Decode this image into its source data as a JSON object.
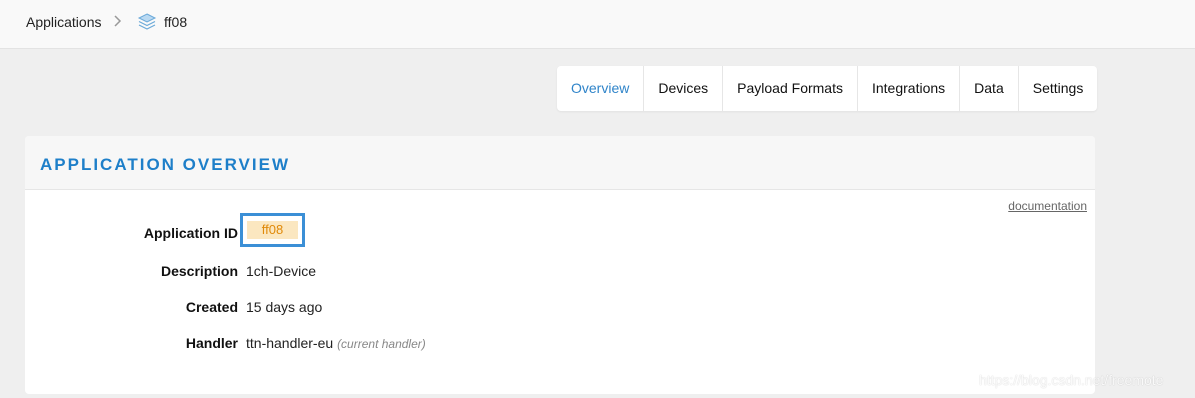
{
  "breadcrumb": {
    "root": "Applications",
    "current": "ff08"
  },
  "tabs": [
    {
      "label": "Overview",
      "active": true
    },
    {
      "label": "Devices"
    },
    {
      "label": "Payload Formats"
    },
    {
      "label": "Integrations"
    },
    {
      "label": "Data"
    },
    {
      "label": "Settings"
    }
  ],
  "overview": {
    "title": "APPLICATION OVERVIEW",
    "documentation_link": "documentation",
    "fields": {
      "app_id_label": "Application ID",
      "app_id_value": "ff08",
      "description_label": "Description",
      "description_value": "1ch-Device",
      "created_label": "Created",
      "created_value": "15 days ago",
      "handler_label": "Handler",
      "handler_value": "ttn-handler-eu",
      "handler_note": "(current handler)"
    }
  },
  "watermark": "https://blog.csdn.net/freemote",
  "colors": {
    "accent": "#1e7fc9",
    "highlight_border": "#3b8fd6",
    "id_pill_bg": "#fbe7c0",
    "id_pill_text": "#e08a0a"
  },
  "icons": {
    "breadcrumb_separator": "chevron-right-icon",
    "application": "layers-icon"
  }
}
